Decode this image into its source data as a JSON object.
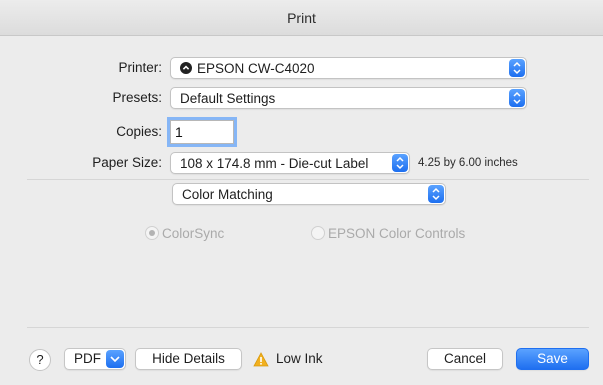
{
  "window": {
    "title": "Print"
  },
  "printer": {
    "label": "Printer:",
    "value": "EPSON CW-C4020"
  },
  "presets": {
    "label": "Presets:",
    "value": "Default Settings"
  },
  "copies": {
    "label": "Copies:",
    "value": "1"
  },
  "paper_size": {
    "label": "Paper Size:",
    "value": "108 x 174.8 mm - Die-cut Label",
    "dimensions": "4.25 by 6.00 inches"
  },
  "panel": {
    "value": "Color Matching"
  },
  "color_options": [
    {
      "label": "ColorSync",
      "selected": true,
      "enabled": false
    },
    {
      "label": "EPSON Color Controls",
      "selected": false,
      "enabled": false
    }
  ],
  "footer": {
    "help_label": "?",
    "pdf_label": "PDF",
    "hide_details_label": "Hide Details",
    "warning_text": "Low Ink",
    "cancel_label": "Cancel",
    "save_label": "Save"
  },
  "colors": {
    "accent": "#1f6ff0",
    "warning": "#f2b01e"
  }
}
